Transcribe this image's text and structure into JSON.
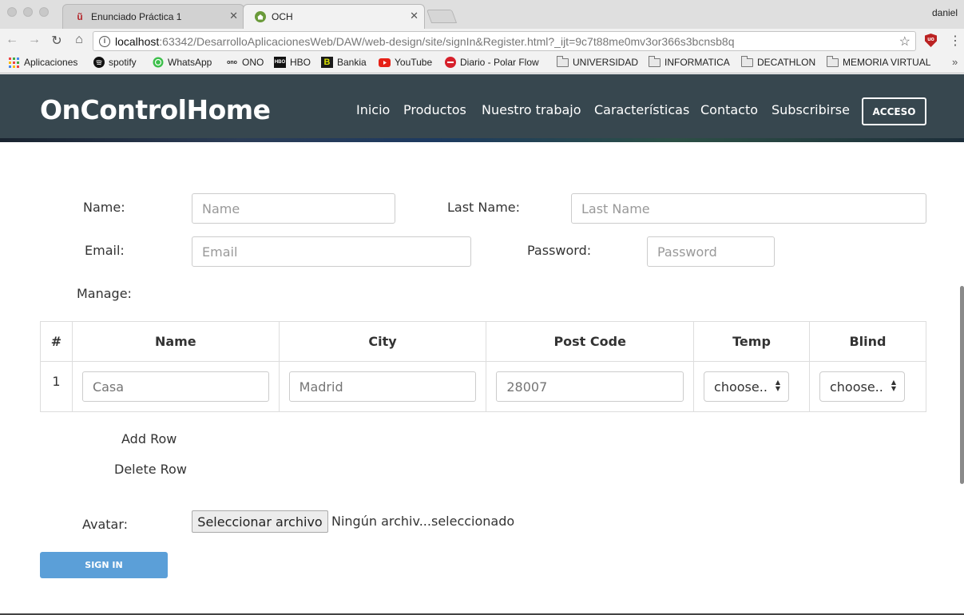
{
  "browser": {
    "tabs": [
      {
        "title": "Enunciado Práctica 1",
        "favicon": "university-crest-icon",
        "active": false
      },
      {
        "title": "OCH",
        "favicon": "home-icon",
        "active": true
      }
    ],
    "profile_name": "daniel",
    "url_host": "localhost",
    "url_path": ":63342/DesarrolloAplicacionesWeb/DAW/web-design/site/signIn&Register.html?_ijt=9c7t88me0mv3or366s3bcnsb8q",
    "bookmarks": [
      {
        "label": "Aplicaciones",
        "icon": "apps-grid-icon"
      },
      {
        "label": "spotify",
        "icon": "spotify-icon"
      },
      {
        "label": "WhatsApp",
        "icon": "whatsapp-icon"
      },
      {
        "label": "ONO",
        "icon": "ono-icon"
      },
      {
        "label": "HBO",
        "icon": "hbo-icon"
      },
      {
        "label": "Bankia",
        "icon": "bankia-icon"
      },
      {
        "label": "YouTube",
        "icon": "youtube-icon"
      },
      {
        "label": "Diario - Polar Flow",
        "icon": "polar-icon"
      },
      {
        "label": "UNIVERSIDAD",
        "icon": "folder-icon"
      },
      {
        "label": "INFORMATICA",
        "icon": "folder-icon"
      },
      {
        "label": "DECATHLON",
        "icon": "folder-icon"
      },
      {
        "label": "MEMORIA VIRTUAL",
        "icon": "folder-icon"
      }
    ],
    "bookmarks_overflow": "»"
  },
  "site": {
    "brand": "OnControlHome",
    "nav": [
      "Inicio",
      "Productos",
      "Nuestro trabajo",
      "Características",
      "Contacto",
      "Subscribirse"
    ],
    "access_label": "ACCESO"
  },
  "form": {
    "name_label": "Name:",
    "name_placeholder": "Name",
    "lastname_label": "Last Name:",
    "lastname_placeholder": "Last Name",
    "email_label": "Email:",
    "email_placeholder": "Email",
    "password_label": "Password:",
    "password_placeholder": "Password",
    "manage_label": "Manage:",
    "table": {
      "headers": [
        "#",
        "Name",
        "City",
        "Post Code",
        "Temp",
        "Blind"
      ],
      "rows": [
        {
          "num": "1",
          "name_placeholder": "Casa",
          "city_placeholder": "Madrid",
          "postcode_placeholder": "28007",
          "temp": "choose..",
          "blind": "choose.."
        }
      ]
    },
    "add_row_label": "Add Row",
    "delete_row_label": "Delete Row",
    "avatar_label": "Avatar:",
    "file_button_label": "Seleccionar archivo",
    "file_status": "Ningún archiv...seleccionado",
    "submit_label": "SIGN IN"
  },
  "colors": {
    "nav_bg": "#37474f",
    "submit_bg": "#5b9fd8"
  }
}
